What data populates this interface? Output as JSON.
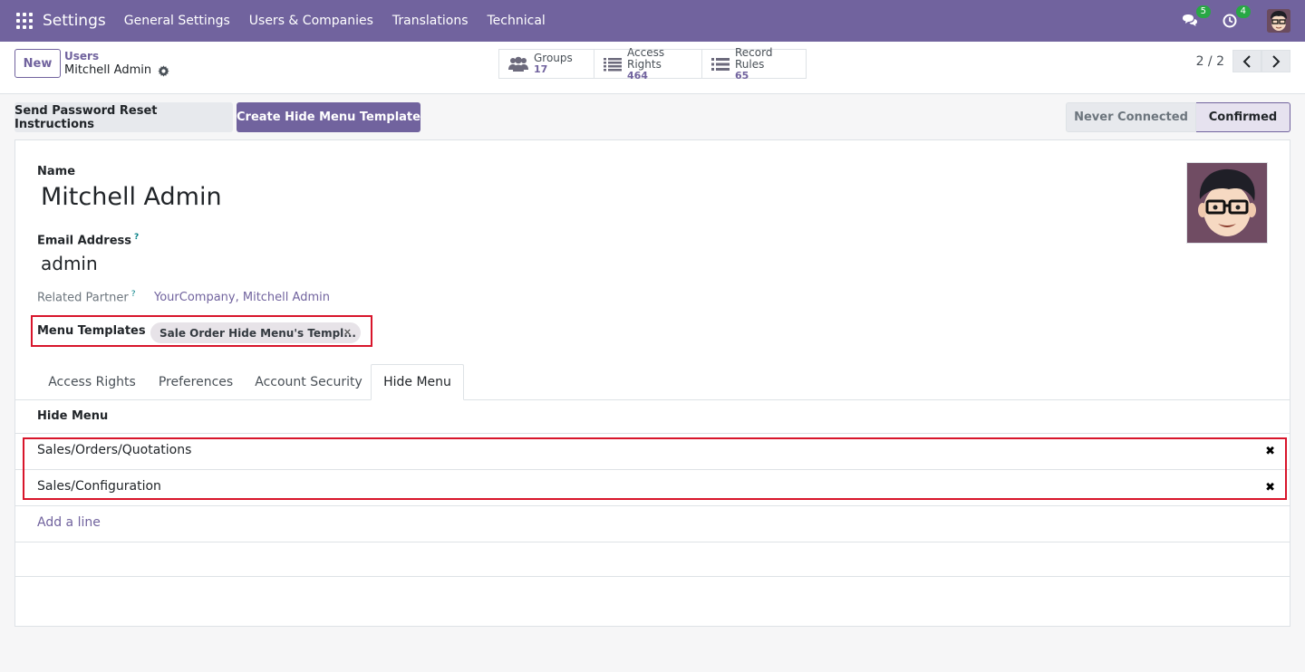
{
  "topnav": {
    "brand": "Settings",
    "menu": [
      "General Settings",
      "Users & Companies",
      "Translations",
      "Technical"
    ],
    "messages_badge": "5",
    "activities_badge": "4"
  },
  "controlpanel": {
    "new_label": "New",
    "breadcrumb_parent": "Users",
    "breadcrumb_current": "Mitchell Admin",
    "smart_buttons": [
      {
        "label": "Groups",
        "value": "17",
        "icon": "users-icon"
      },
      {
        "label": "Access Rights",
        "value": "464",
        "icon": "list-icon"
      },
      {
        "label": "Record Rules",
        "value": "65",
        "icon": "list-icon"
      }
    ],
    "pager": "2 / 2"
  },
  "statusbar": {
    "secondary_button": "Send Password Reset Instructions",
    "primary_button": "Create Hide Menu Template",
    "stages": [
      "Never Connected",
      "Confirmed"
    ],
    "active_stage": "Confirmed"
  },
  "form": {
    "name_label": "Name",
    "name_value": "Mitchell Admin",
    "email_label": "Email Address",
    "email_value": "admin",
    "help_mark": "?",
    "partner_label": "Related Partner",
    "partner_value": "YourCompany, Mitchell Admin",
    "templates_label": "Menu Templates",
    "templates_tag": "Sale Order Hide Menu's Templ...",
    "tag_remove": "×"
  },
  "tabs": [
    "Access Rights",
    "Preferences",
    "Account Security",
    "Hide Menu"
  ],
  "active_tab": "Hide Menu",
  "hide_menu": {
    "header": "Hide Menu",
    "rows": [
      "Sales/Orders/Quotations",
      "Sales/Configuration"
    ],
    "delete_glyph": "✖",
    "add_line": "Add a line"
  },
  "colors": {
    "brand": "#71639e",
    "highlight": "#d8152b",
    "badge": "#28a745"
  }
}
